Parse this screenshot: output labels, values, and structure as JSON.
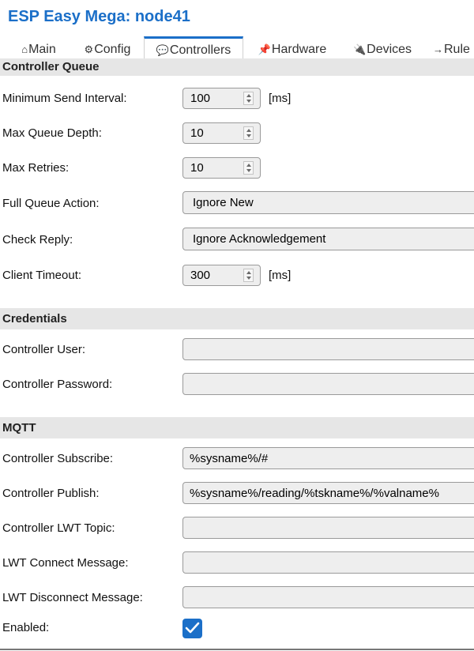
{
  "app": {
    "title": "ESP Easy Mega: node41"
  },
  "tabs": [
    {
      "icon": "⌂",
      "label": "Main"
    },
    {
      "icon": "⚙",
      "label": "Config"
    },
    {
      "icon": "💬",
      "label": "Controllers"
    },
    {
      "icon": "📌",
      "label": "Hardware"
    },
    {
      "icon": "🔌",
      "label": "Devices"
    },
    {
      "icon": "→",
      "label": "Rule"
    }
  ],
  "active_tab": "Controllers",
  "sections": {
    "queue": "Controller Queue",
    "credentials": "Credentials",
    "mqtt": "MQTT"
  },
  "queue": {
    "min_send_interval": {
      "label": "Minimum Send Interval:",
      "value": "100",
      "unit": "[ms]"
    },
    "max_queue_depth": {
      "label": "Max Queue Depth:",
      "value": "10"
    },
    "max_retries": {
      "label": "Max Retries:",
      "value": "10"
    },
    "full_queue_action": {
      "label": "Full Queue Action:",
      "value": "Ignore New"
    },
    "check_reply": {
      "label": "Check Reply:",
      "value": "Ignore Acknowledgement"
    },
    "client_timeout": {
      "label": "Client Timeout:",
      "value": "300",
      "unit": "[ms]"
    }
  },
  "credentials": {
    "user": {
      "label": "Controller User:",
      "value": ""
    },
    "password": {
      "label": "Controller Password:",
      "value": ""
    }
  },
  "mqtt": {
    "subscribe": {
      "label": "Controller Subscribe:",
      "value": "%sysname%/#"
    },
    "publish": {
      "label": "Controller Publish:",
      "value": "%sysname%/reading/%tskname%/%valname%"
    },
    "lwt_topic": {
      "label": "Controller LWT Topic:",
      "value": ""
    },
    "lwt_connect": {
      "label": "LWT Connect Message:",
      "value": ""
    },
    "lwt_disconnect": {
      "label": "LWT Disconnect Message:",
      "value": ""
    }
  },
  "enabled": {
    "label": "Enabled:",
    "checked": true
  },
  "colors": {
    "accent": "#1b6fc8",
    "section_bg": "#e6e6e6",
    "input_bg": "#eeeeee"
  }
}
